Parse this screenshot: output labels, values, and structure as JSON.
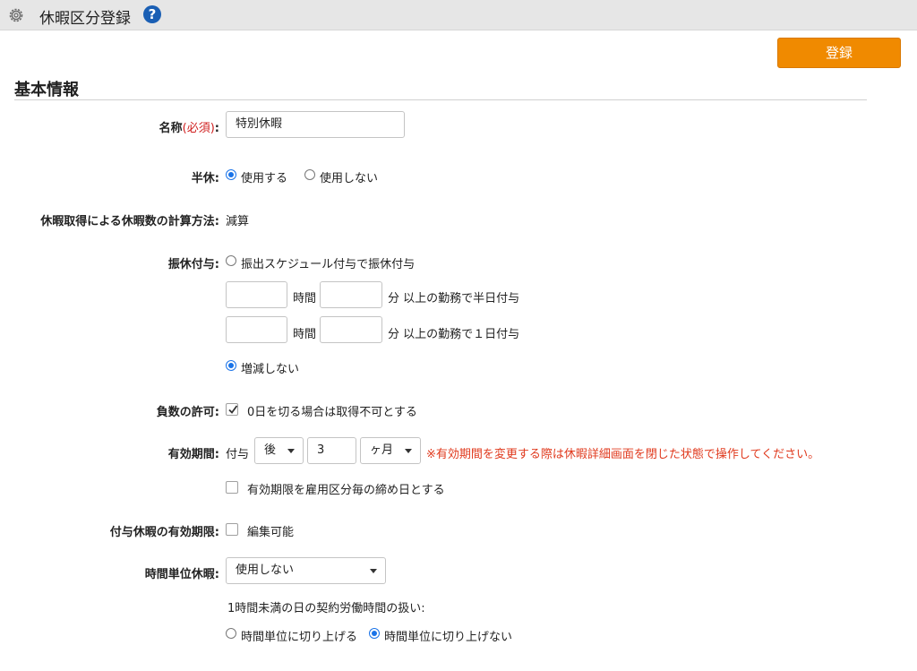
{
  "header": {
    "title": "休暇区分登録",
    "help_label": "?"
  },
  "toolbar": {
    "submit_label": "登録"
  },
  "section": {
    "title": "基本情報"
  },
  "name_row": {
    "label": "名称",
    "required": "(必須)",
    "colon": ":",
    "value": "特別休暇"
  },
  "half_day": {
    "label": "半休:",
    "opt_use": "使用する",
    "opt_nouse": "使用しない",
    "selected": "使用する"
  },
  "calc_method": {
    "label": "休暇取得による休暇数の計算方法:",
    "value": "減算"
  },
  "substitute": {
    "label": "振休付与:",
    "opt_schedule": "振出スケジュール付与で振休付与",
    "hours_label": "時間",
    "minutes_half": "分 以上の勤務で半日付与",
    "minutes_full": "分 以上の勤務で１日付与",
    "opt_none": "増減しない",
    "selected": "増減しない"
  },
  "negative": {
    "label": "負数の許可:",
    "checkbox_label": "0日を切る場合は取得不可とする",
    "checked": true
  },
  "validity": {
    "label": "有効期間:",
    "prefix": "付与",
    "direction": "後",
    "amount": "3",
    "unit": "ヶ月",
    "warning": "※有効期間を変更する際は休暇詳細画面を閉じた状態で操作してください。",
    "closing_label": "有効期限を雇用区分毎の締め日とする"
  },
  "granted_expiry": {
    "label": "付与休暇の有効期限:",
    "checkbox_label": "編集可能"
  },
  "hourly": {
    "label": "時間単位休暇:",
    "value": "使用しない",
    "note": "1時間未満の日の契約労働時間の扱い:",
    "opt_round": "時間単位に切り上げる",
    "opt_noround": "時間単位に切り上げない",
    "selected": "時間単位に切り上げない"
  },
  "colors": {
    "accent": "#f08a00",
    "radio": "#1a73e8",
    "warning": "#e03a1e",
    "required": "#d02020"
  }
}
